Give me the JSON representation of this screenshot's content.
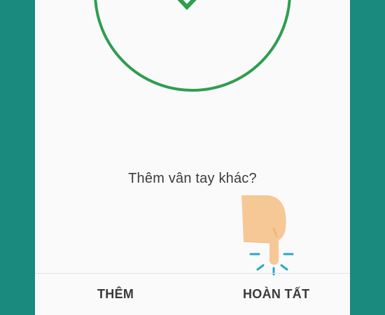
{
  "colors": {
    "background": "#1a8a7e",
    "screen": "#fafafa",
    "success_green": "#2e9e4f",
    "tap_ripple": "#2aa7c7",
    "hand_skin": "#f6c896"
  },
  "icons": {
    "success": "checkmark-circle-icon",
    "pointer": "pointing-hand-icon"
  },
  "prompt": {
    "text": "Thêm vân tay khác?"
  },
  "actions": {
    "add_label": "THÊM",
    "done_label": "HOÀN TẤT"
  }
}
